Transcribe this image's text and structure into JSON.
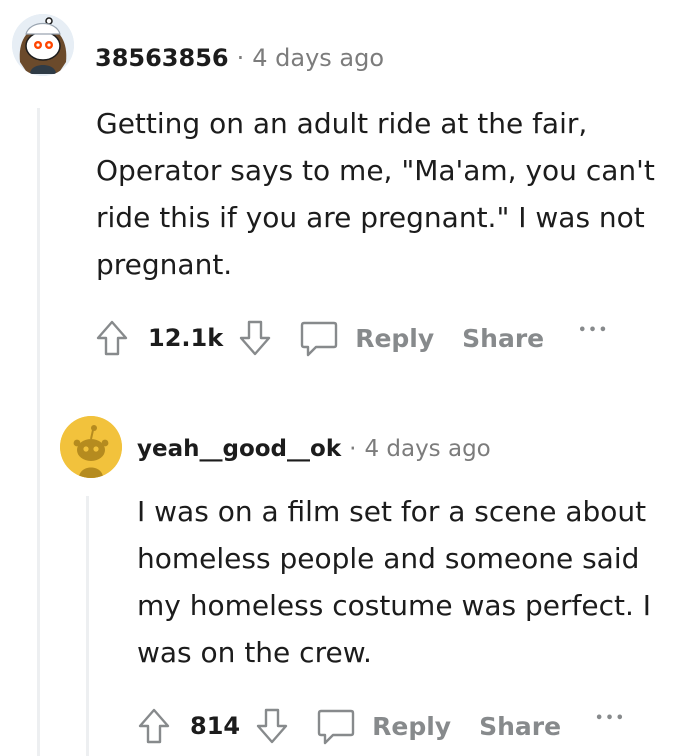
{
  "comments": [
    {
      "username": "38563856",
      "separator": "·",
      "time": "4 days ago",
      "body": "Getting on an adult ride at the fair, Operator says to me, \"Ma'am, you can't ride this if you are pregnant.\" I was not pregnant.",
      "score": "12.1k",
      "reply_label": "Reply",
      "share_label": "Share",
      "more_label": "•••"
    },
    {
      "username": "yeah__good__ok",
      "separator": "·",
      "time": "4 days ago",
      "body": "I was on a film set for a scene about homeless people and someone said my homeless costume was perfect. I was on the crew.",
      "score": "814",
      "reply_label": "Reply",
      "share_label": "Share",
      "more_label": "•••"
    }
  ],
  "colors": {
    "text": "#1c1c1c",
    "meta": "#7c7c7c",
    "action": "#878a8c",
    "thread_line": "#edeff1",
    "avatar2_bg": "#f2c23c"
  }
}
